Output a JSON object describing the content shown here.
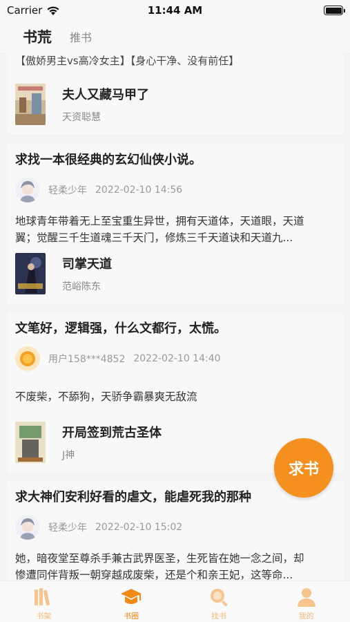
{
  "status_bar": {
    "carrier": "Carrier",
    "time": "11:44 AM"
  },
  "header": {
    "tabs": [
      {
        "label": "书荒"
      },
      {
        "label": "推书"
      }
    ]
  },
  "posts": [
    {
      "partial_text": "【傲娇男主vs高冷女主】【身心干净、没有前任】",
      "book": {
        "title": "夫人又藏马甲了",
        "author": "天资聪慧"
      }
    },
    {
      "title": "求找一本很经典的玄幻仙侠小说。",
      "user": "轻柔少年",
      "time": "2022-02-10 14:56",
      "desc_line1": "地球青年带着无上至宝重生异世，拥有天道体，天道眼，天道",
      "desc_line2": "翼；觉醒三千生道魂三千天门，修炼三千天道诀和天道九...",
      "book": {
        "title": "司掌天道",
        "author": "范峪陈东"
      }
    },
    {
      "title": "文笔好，逻辑强，什么文都行，太慌。",
      "user": "用户158***4852",
      "time": "2022-02-10 14:40",
      "desc_line1": "不废柴，不舔狗，天骄争霸暴爽无敌流",
      "book": {
        "title": "开局签到荒古圣体",
        "author": "J神"
      }
    },
    {
      "title": "求大神们安利好看的虐文，能虐死我的那种",
      "user": "轻柔少年",
      "time": "2022-02-10 15:02",
      "desc_line1": "她，暗夜堂至尊杀手兼古武界医圣，生死皆在她一念之间，却",
      "desc_line2": "惨遭同伴背叛一朝穿越成废柴，还是个和亲王妃，这等命..."
    }
  ],
  "fab": {
    "label": "求书"
  },
  "bottom_nav": [
    {
      "label": "书架",
      "icon": "bookshelf-icon"
    },
    {
      "label": "书圈",
      "icon": "graduation-cap-icon"
    },
    {
      "label": "找书",
      "icon": "search-icon"
    },
    {
      "label": "我的",
      "icon": "profile-icon"
    }
  ],
  "colors": {
    "accent": "#f08a14",
    "accent_light": "#f5b878",
    "background": "#f3f3f3",
    "card": "#f8f8f8"
  }
}
